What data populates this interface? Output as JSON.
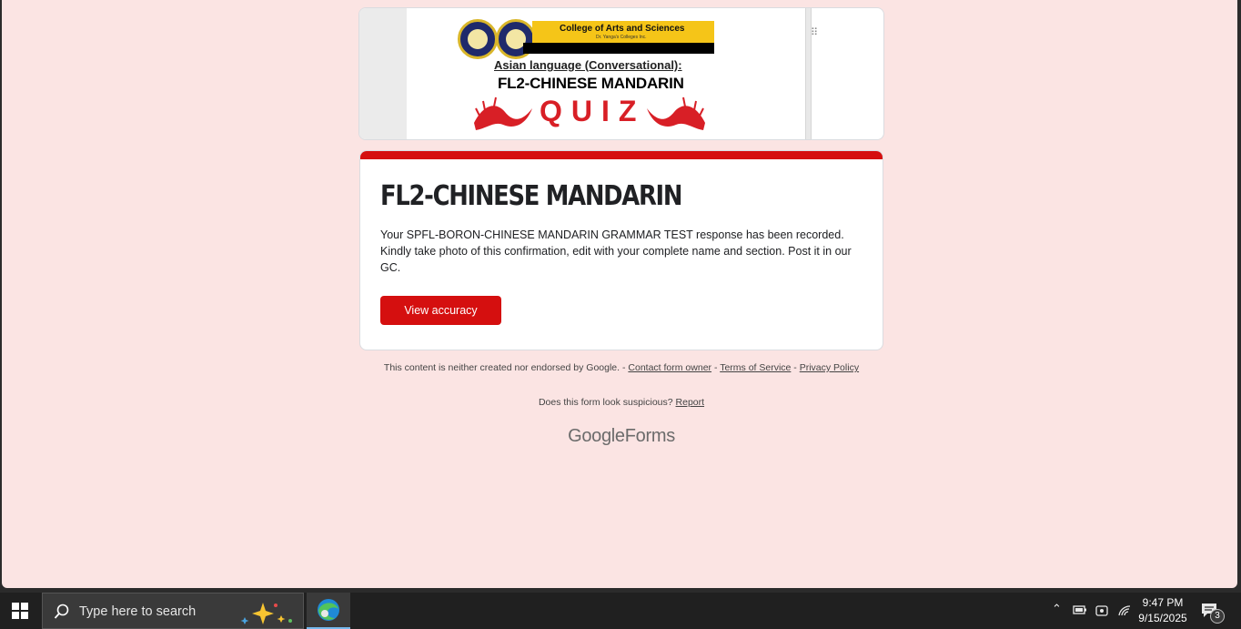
{
  "banner": {
    "college": "College of Arts and Sciences",
    "college_sub": "Dr. Yanga's Colleges Inc.",
    "subtitle": "Asian language (Conversational):",
    "course": "FL2-CHINESE MANDARIN",
    "quiz_word": "QUIZ"
  },
  "confirmation": {
    "title": "FL2-CHINESE MANDARIN",
    "message": "Your SPFL-BORON-CHINESE MANDARIN GRAMMAR TEST response has been recorded. Kindly take photo of this confirmation, edit with your complete name and section. Post it in our GC.",
    "button_label": "View accuracy"
  },
  "footer": {
    "disclaimer": "This content is neither created nor endorsed by Google. -",
    "contact_link": "Contact form owner",
    "sep1": "-",
    "terms_link": "Terms of Service",
    "sep2": "-",
    "privacy_link": "Privacy Policy",
    "suspicious_text": "Does this form look suspicious?",
    "report_link": "Report",
    "logo_google": "Google",
    "logo_forms": "Forms"
  },
  "taskbar": {
    "search_placeholder": "Type here to search",
    "time": "9:47 PM",
    "date": "9/15/2025",
    "notification_count": "3"
  },
  "colors": {
    "accent": "#d50f0f",
    "page_bg": "#fbe4e3",
    "taskbar_bg": "#202020"
  }
}
